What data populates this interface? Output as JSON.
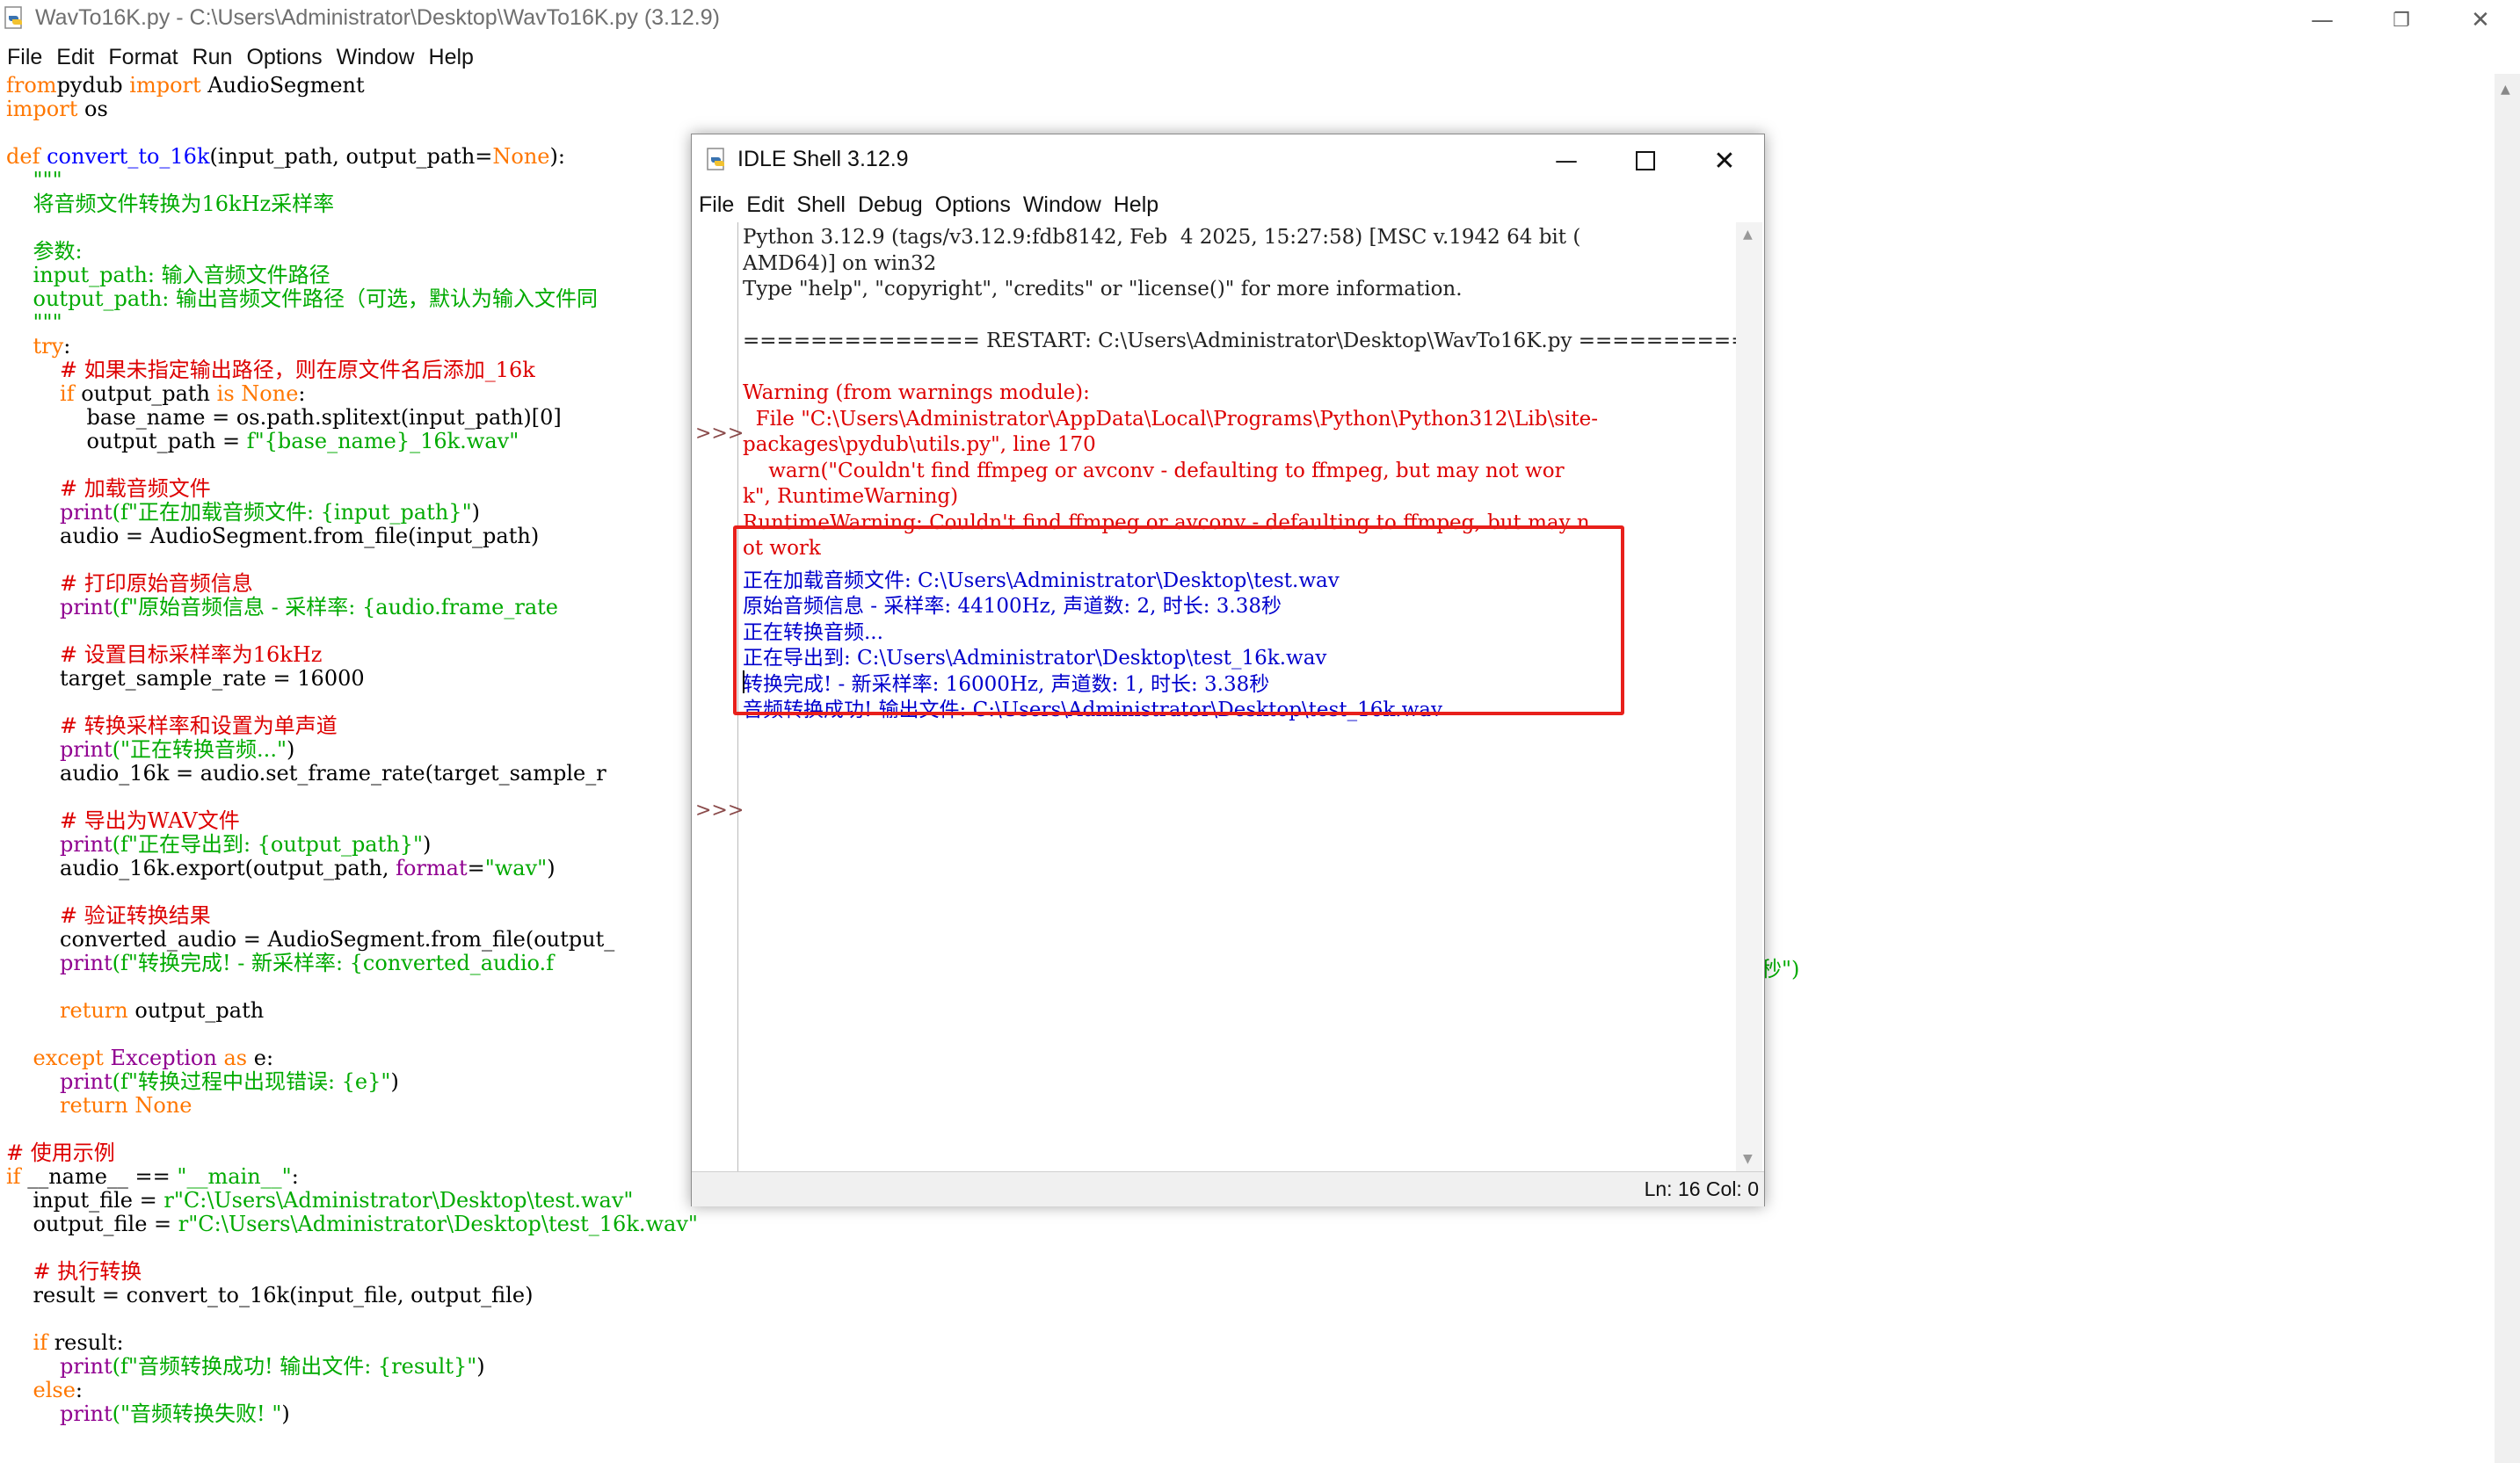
{
  "editor": {
    "title": "WavTo16K.py - C:\\Users\\Administrator\\Desktop\\WavTo16K.py (3.12.9)",
    "menu": [
      "File",
      "Edit",
      "Format",
      "Run",
      "Options",
      "Window",
      "Help"
    ],
    "right_overflow_text": "秒\")"
  },
  "shell": {
    "title": "IDLE Shell 3.12.9",
    "menu": [
      "File",
      "Edit",
      "Shell",
      "Debug",
      "Options",
      "Window",
      "Help"
    ],
    "prompt": ">>>",
    "status": "Ln: 16  Col: 0",
    "lines": [
      {
        "text": "Python 3.12.9 (tags/v3.12.9:fdb8142, Feb  4 2025, 15:27:58) [MSC v.1942 64 bit (",
        "style": "out"
      },
      {
        "text": "AMD64)] on win32",
        "style": "out"
      },
      {
        "text": "Type \"help\", \"copyright\", \"credits\" or \"license()\" for more information.",
        "style": "out"
      },
      {
        "text": "",
        "style": "out"
      },
      {
        "text": "============== RESTART: C:\\Users\\Administrator\\Desktop\\WavTo16K.py =============",
        "style": "out"
      },
      {
        "text": "",
        "style": "out"
      },
      {
        "text": "Warning (from warnings module):",
        "style": "warn"
      },
      {
        "text": "  File \"C:\\Users\\Administrator\\AppData\\Local\\Programs\\Python\\Python312\\Lib\\site-",
        "style": "warn"
      },
      {
        "text": "packages\\pydub\\utils.py\", line 170",
        "style": "warn"
      },
      {
        "text": "    warn(\"Couldn't find ffmpeg or avconv - defaulting to ffmpeg, but may not wor",
        "style": "warn"
      },
      {
        "text": "k\", RuntimeWarning)",
        "style": "warn"
      },
      {
        "text": "RuntimeWarning: Couldn't find ffmpeg or avconv - defaulting to ffmpeg, but may n",
        "style": "warn"
      },
      {
        "text": "ot work",
        "style": "warn"
      },
      {
        "text": "正在加载音频文件: C:\\Users\\Administrator\\Desktop\\test.wav",
        "style": "blue"
      },
      {
        "text": "原始音频信息 - 采样率: 44100Hz, 声道数: 2, 时长: 3.38秒",
        "style": "blue"
      },
      {
        "text": "正在转换音频...",
        "style": "blue"
      },
      {
        "text": "正在导出到: C:\\Users\\Administrator\\Desktop\\test_16k.wav",
        "style": "blue"
      },
      {
        "text": "转换完成! - 新采样率: 16000Hz, 声道数: 1, 时长: 3.38秒",
        "style": "blue"
      },
      {
        "text": "音频转换成功! 输出文件: C:\\Users\\Administrator\\Desktop\\test_16k.wav",
        "style": "blue"
      }
    ]
  },
  "code_lines": [
    [
      [
        "kw",
        "from"
      ],
      [
        "",
        "pydub "
      ],
      [
        "kw",
        "import"
      ],
      [
        "",
        " AudioSegment"
      ]
    ],
    [
      [
        "kw",
        "import"
      ],
      [
        "",
        " os"
      ]
    ],
    [],
    [
      [
        "kw",
        "def"
      ],
      [
        "",
        " "
      ],
      [
        "fn",
        "convert_to_16k"
      ],
      [
        "",
        "(input_path, output_path="
      ],
      [
        "kw",
        "None"
      ],
      [
        "",
        "):"
      ]
    ],
    [
      [
        "str",
        "    \"\"\""
      ]
    ],
    [
      [
        "str",
        "    将音频文件转换为16kHz采样率"
      ]
    ],
    [],
    [
      [
        "str",
        "    参数:"
      ]
    ],
    [
      [
        "str",
        "    input_path: 输入音频文件路径"
      ]
    ],
    [
      [
        "str",
        "    output_path: 输出音频文件路径（可选，默认为输入文件同"
      ]
    ],
    [
      [
        "str",
        "    \"\"\""
      ]
    ],
    [
      [
        "",
        "    "
      ],
      [
        "kw",
        "try"
      ],
      [
        "",
        ":"
      ]
    ],
    [
      [
        "cm",
        "        # 如果未指定输出路径，则在原文件名后添加_16k"
      ]
    ],
    [
      [
        "",
        "        "
      ],
      [
        "kw",
        "if"
      ],
      [
        "",
        " output_path "
      ],
      [
        "kw",
        "is"
      ],
      [
        "",
        " "
      ],
      [
        "kw",
        "None"
      ],
      [
        "",
        ":"
      ]
    ],
    [
      [
        "",
        "            base_name = os.path.splitext(input_path)[0]"
      ]
    ],
    [
      [
        "",
        "            output_path = "
      ],
      [
        "str",
        "f\"{base_name}_16k.wav\""
      ]
    ],
    [],
    [
      [
        "cm",
        "        # 加载音频文件"
      ]
    ],
    [
      [
        "",
        "        "
      ],
      [
        "bi",
        "print"
      ],
      [
        "str",
        "(f\"正在加载音频文件: {input_path}\""
      ],
      [
        "",
        ")"
      ]
    ],
    [
      [
        "",
        "        audio = AudioSegment.from_file(input_path)"
      ]
    ],
    [],
    [
      [
        "cm",
        "        # 打印原始音频信息"
      ]
    ],
    [
      [
        "",
        "        "
      ],
      [
        "bi",
        "print"
      ],
      [
        "str",
        "(f\"原始音频信息 - 采样率: {audio.frame_rate"
      ]
    ],
    [],
    [
      [
        "cm",
        "        # 设置目标采样率为16kHz"
      ]
    ],
    [
      [
        "",
        "        target_sample_rate = 16000"
      ]
    ],
    [],
    [
      [
        "cm",
        "        # 转换采样率和设置为单声道"
      ]
    ],
    [
      [
        "",
        "        "
      ],
      [
        "bi",
        "print"
      ],
      [
        "str",
        "(\"正在转换音频...\""
      ],
      [
        "",
        ")"
      ]
    ],
    [
      [
        "",
        "        audio_16k = audio.set_frame_rate(target_sample_r"
      ]
    ],
    [],
    [
      [
        "cm",
        "        # 导出为WAV文件"
      ]
    ],
    [
      [
        "",
        "        "
      ],
      [
        "bi",
        "print"
      ],
      [
        "str",
        "(f\"正在导出到: {output_path}\""
      ],
      [
        "",
        ")"
      ]
    ],
    [
      [
        "",
        "        audio_16k.export(output_path, "
      ],
      [
        "bi",
        "format"
      ],
      [
        "",
        "="
      ],
      [
        "str",
        "\"wav\""
      ],
      [
        "",
        ")"
      ]
    ],
    [],
    [
      [
        "cm",
        "        # 验证转换结果"
      ]
    ],
    [
      [
        "",
        "        converted_audio = AudioSegment.from_file(output_"
      ]
    ],
    [
      [
        "",
        "        "
      ],
      [
        "bi",
        "print"
      ],
      [
        "str",
        "(f\"转换完成! - 新采样率: {converted_audio.f"
      ]
    ],
    [],
    [
      [
        "",
        "        "
      ],
      [
        "kw",
        "return"
      ],
      [
        "",
        " output_path"
      ]
    ],
    [],
    [
      [
        "",
        "    "
      ],
      [
        "kw",
        "except"
      ],
      [
        "",
        " "
      ],
      [
        "bi",
        "Exception"
      ],
      [
        "",
        " "
      ],
      [
        "kw",
        "as"
      ],
      [
        "",
        " e:"
      ]
    ],
    [
      [
        "",
        "        "
      ],
      [
        "bi",
        "print"
      ],
      [
        "str",
        "(f\"转换过程中出现错误: {e}\""
      ],
      [
        "",
        ")"
      ]
    ],
    [
      [
        "",
        "        "
      ],
      [
        "kw",
        "return"
      ],
      [
        "",
        " "
      ],
      [
        "kw",
        "None"
      ]
    ],
    [],
    [
      [
        "cm",
        "# 使用示例"
      ]
    ],
    [
      [
        "kw",
        "if"
      ],
      [
        "",
        " __name__ == "
      ],
      [
        "str",
        "\"__main__\""
      ],
      [
        "",
        ":"
      ]
    ],
    [
      [
        "",
        "    input_file = "
      ],
      [
        "str",
        "r\"C:\\Users\\Administrator\\Desktop\\test.wav\""
      ]
    ],
    [
      [
        "",
        "    output_file = "
      ],
      [
        "str",
        "r\"C:\\Users\\Administrator\\Desktop\\test_16k.wav\""
      ]
    ],
    [],
    [
      [
        "cm",
        "    # 执行转换"
      ]
    ],
    [
      [
        "",
        "    result = convert_to_16k(input_file, output_file)"
      ]
    ],
    [],
    [
      [
        "",
        "    "
      ],
      [
        "kw",
        "if"
      ],
      [
        "",
        " result:"
      ]
    ],
    [
      [
        "",
        "        "
      ],
      [
        "bi",
        "print"
      ],
      [
        "str",
        "(f\"音频转换成功! 输出文件: {result}\""
      ],
      [
        "",
        ")"
      ]
    ],
    [
      [
        "",
        "    "
      ],
      [
        "kw",
        "else"
      ],
      [
        "",
        ":"
      ]
    ],
    [
      [
        "",
        "        "
      ],
      [
        "bi",
        "print"
      ],
      [
        "str",
        "(\"音频转换失败! \""
      ],
      [
        "",
        ")"
      ]
    ]
  ]
}
